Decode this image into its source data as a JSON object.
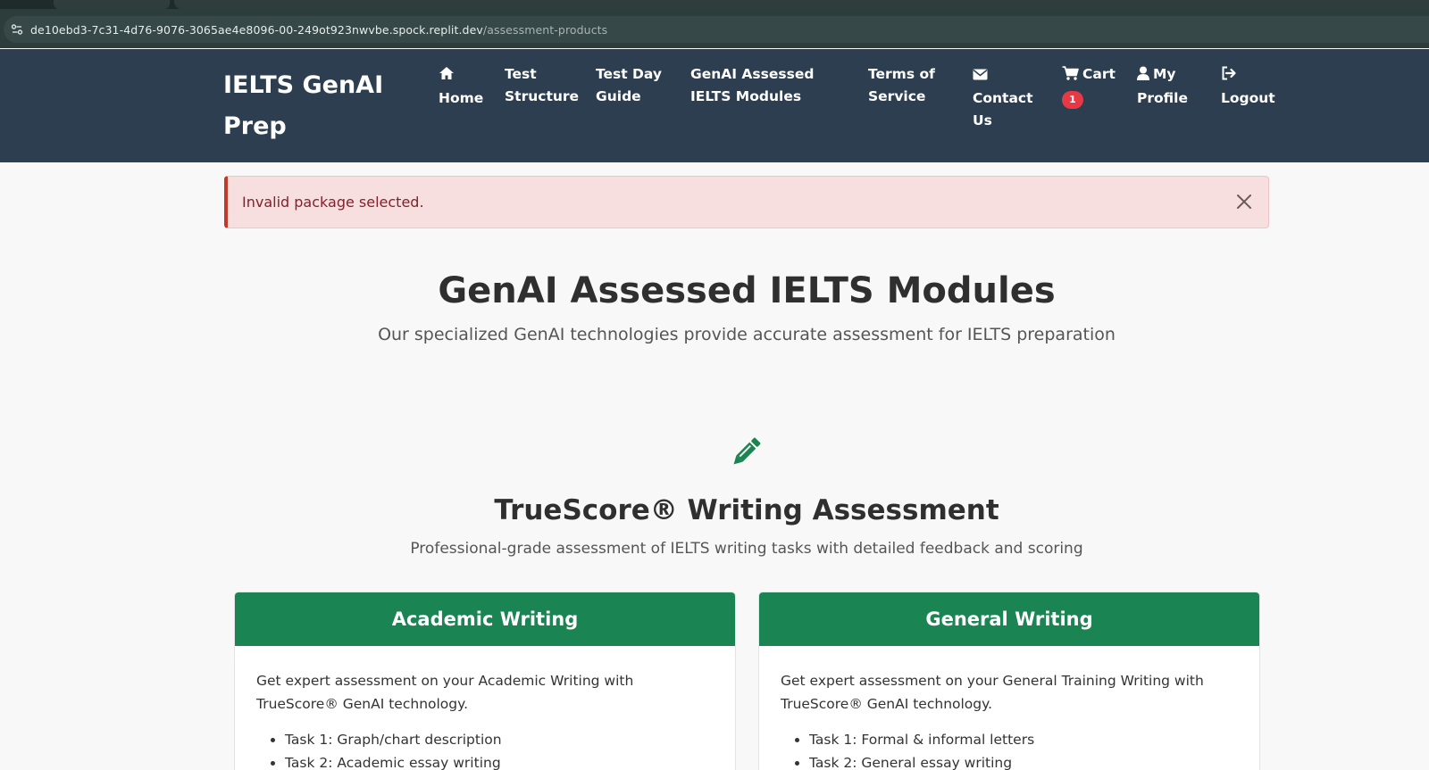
{
  "browser": {
    "url_host": "de10ebd3-7c31-4d76-9076-3065ae4e8096-00-249ot923nwvbe.spock.replit.dev",
    "url_path": "/assessment-products"
  },
  "navbar": {
    "brand": "IELTS GenAI Prep",
    "items": [
      {
        "label": "Home",
        "icon": "home-icon"
      },
      {
        "label": "Test Structure"
      },
      {
        "label": "Test Day Guide"
      },
      {
        "label": "GenAI Assessed IELTS Modules"
      },
      {
        "label": "Terms of Service"
      },
      {
        "label": "Contact Us",
        "icon": "envelope-icon"
      },
      {
        "label": "Cart",
        "icon": "cart-icon",
        "badge": "1"
      },
      {
        "label": "My Profile",
        "icon": "user-icon"
      },
      {
        "label": "Logout",
        "icon": "logout-icon"
      }
    ]
  },
  "alert": {
    "message": "Invalid package selected.",
    "color": "#c0392b"
  },
  "main": {
    "title": "GenAI Assessed IELTS Modules",
    "subtitle": "Our specialized GenAI technologies provide accurate assessment for IELTS preparation"
  },
  "section": {
    "icon": "pencil-icon",
    "title": "TrueScore® Writing Assessment",
    "subtitle": "Professional-grade assessment of IELTS writing tasks with detailed feedback and scoring",
    "accent": "#1a8452"
  },
  "cards": [
    {
      "header": "Academic Writing",
      "description": "Get expert assessment on your Academic Writing with TrueScore® GenAI technology.",
      "items": [
        "Task 1: Graph/chart description",
        "Task 2: Academic essay writing"
      ]
    },
    {
      "header": "General Writing",
      "description": "Get expert assessment on your General Training Writing with TrueScore® GenAI technology.",
      "items": [
        "Task 1: Formal & informal letters",
        "Task 2: General essay writing"
      ]
    }
  ]
}
